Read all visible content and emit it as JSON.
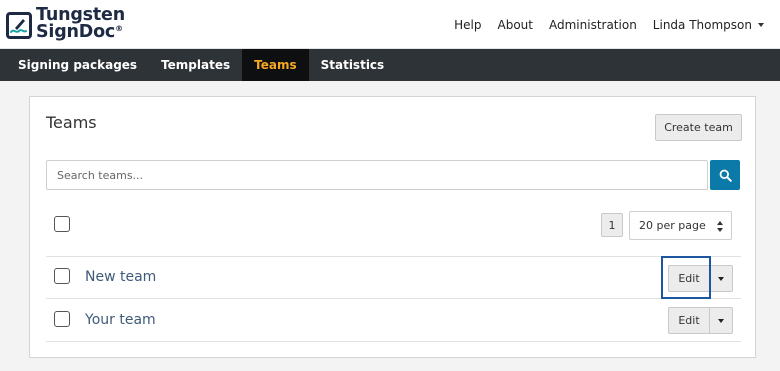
{
  "brand": {
    "line1": "Tungsten",
    "line2": "SignDoc",
    "reg": "®"
  },
  "topnav": {
    "help": "Help",
    "about": "About",
    "administration": "Administration",
    "user": "Linda Thompson"
  },
  "tabs": [
    {
      "label": "Signing packages",
      "active": false
    },
    {
      "label": "Templates",
      "active": false
    },
    {
      "label": "Teams",
      "active": true
    },
    {
      "label": "Statistics",
      "active": false
    }
  ],
  "teams_page": {
    "title": "Teams",
    "create_label": "Create team",
    "search_placeholder": "Search teams...",
    "page_number": "1",
    "per_page": "20 per page",
    "rows": [
      {
        "name": "New team",
        "edit_label": "Edit",
        "highlighted": true
      },
      {
        "name": "Your team",
        "edit_label": "Edit",
        "highlighted": false
      }
    ]
  },
  "colors": {
    "navbar": "#2e3337",
    "active_tab_text": "#f6a821",
    "search_button": "#0b7aa8",
    "highlight": "#1d56a0",
    "team_link": "#3e5a78"
  },
  "icons": {
    "logo": "pen-signature-icon",
    "search": "search-icon",
    "dropdown": "caret-down-icon",
    "sort": "sort-icon"
  }
}
